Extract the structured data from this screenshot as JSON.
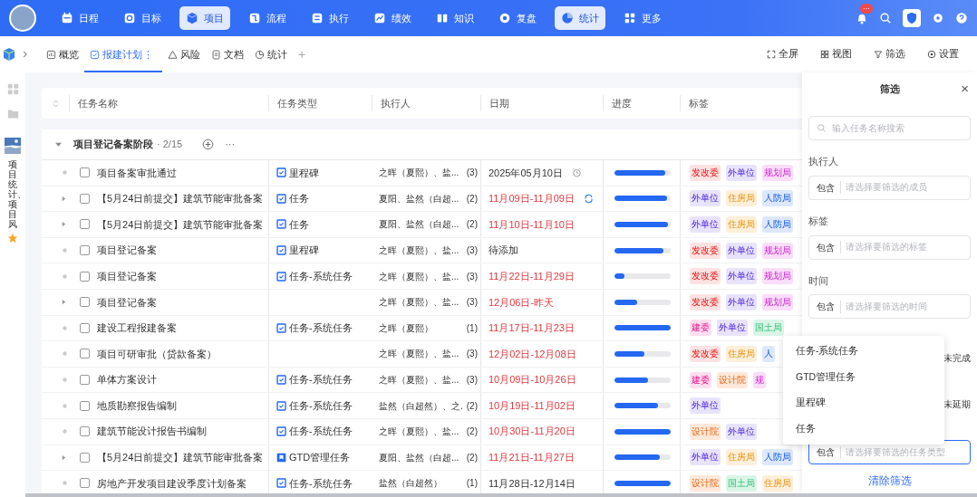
{
  "nav": {
    "items": [
      {
        "label": "日程",
        "selected": false
      },
      {
        "label": "目标",
        "selected": false
      },
      {
        "label": "项目",
        "selected": true
      },
      {
        "label": "流程",
        "selected": false
      },
      {
        "label": "执行",
        "selected": false
      },
      {
        "label": "绩效",
        "selected": false
      },
      {
        "label": "知识",
        "selected": false
      },
      {
        "label": "复盘",
        "selected": false
      },
      {
        "label": "统计",
        "selected": true
      },
      {
        "label": "更多",
        "selected": false
      }
    ],
    "notification_badge": "···"
  },
  "tabs": [
    {
      "label": "概览",
      "selected": false
    },
    {
      "label": "报建计划",
      "selected": true
    },
    {
      "label": "风险",
      "selected": false
    },
    {
      "label": "文档",
      "selected": false
    },
    {
      "label": "统计",
      "selected": false
    }
  ],
  "tab_menu": "⋮",
  "tab_add": "+",
  "toolbar": [
    "全屏",
    "视图",
    "筛选",
    "设置"
  ],
  "rail": {
    "vertical_text": "项目统计、项目风"
  },
  "table": {
    "columns": [
      "任务名称",
      "任务类型",
      "执行人",
      "日期",
      "进度",
      "标签"
    ],
    "group": {
      "name": "项目登记备案阶段",
      "count": "· 2/15",
      "more": "···",
      "expanded": true
    },
    "rows": [
      {
        "expandable": false,
        "checked": false,
        "name": "项目备案审批通过",
        "type": {
          "kind": "check",
          "label": "里程碑"
        },
        "executor": "之晖（夏熙）、盐...",
        "count": "(3)",
        "date": "2025年05月10日",
        "overdue": false,
        "reminder": true,
        "level": 0.9,
        "tags": [
          {
            "label": "发改委",
            "color": "#fde2e2"
          },
          {
            "label": "外单位",
            "color": "#e8e3fc"
          },
          {
            "label": "规划局",
            "color": "#f9ddf9"
          }
        ]
      },
      {
        "expandable": true,
        "checked": false,
        "name": "【5月24日前提交】建筑节能审批备案",
        "type": {
          "kind": "check",
          "label": "任务"
        },
        "executor": "夏阳、盐然（白超...",
        "count": "(2)",
        "date": "11月09日-11月09日",
        "overdue": true,
        "recurring": true,
        "level": 0.93,
        "tags": [
          {
            "label": "外单位",
            "color": "#e8e3fc"
          },
          {
            "label": "住房局",
            "color": "#fdefd9"
          },
          {
            "label": "人防局",
            "color": "#dde8fd"
          }
        ]
      },
      {
        "expandable": true,
        "checked": false,
        "name": "【5月24日前提交】建筑节能审批备案",
        "type": {
          "kind": "check",
          "label": "任务"
        },
        "executor": "夏阳、盐然（白超...",
        "count": "(2)",
        "date": "11月10日-11月10日",
        "overdue": true,
        "level": 0.95,
        "tags": [
          {
            "label": "外单位",
            "color": "#e8e3fc"
          },
          {
            "label": "住房局",
            "color": "#fdefd9"
          },
          {
            "label": "人防局",
            "color": "#dde8fd"
          }
        ]
      },
      {
        "expandable": false,
        "checked": false,
        "name": "项目登记备案",
        "type": {
          "kind": "check",
          "label": "里程碑"
        },
        "executor": "之晖（夏熙）、盐...",
        "count": "(3)",
        "date": "待添加",
        "overdue": false,
        "level": 0.87,
        "tags": [
          {
            "label": "发改委",
            "color": "#fde2e2"
          },
          {
            "label": "外单位",
            "color": "#e8e3fc"
          },
          {
            "label": "规划局",
            "color": "#f9ddf9"
          }
        ]
      },
      {
        "expandable": false,
        "checked": false,
        "name": "项目登记备案",
        "type": {
          "kind": "check",
          "label": "任务-系统任务"
        },
        "executor": "之晖（夏熙）、盐...",
        "count": "(3)",
        "date": "11月22日-11月29日",
        "overdue": true,
        "level": 0.17,
        "tags": [
          {
            "label": "发改委",
            "color": "#fde2e2"
          },
          {
            "label": "外单位",
            "color": "#e8e3fc"
          },
          {
            "label": "规划局",
            "color": "#f9ddf9"
          }
        ]
      },
      {
        "expandable": true,
        "checked": false,
        "name": "项目登记备案",
        "executor": "之晖（夏熙）、盐...",
        "count": "(3)",
        "date": "12月06日-昨天",
        "overdue": true,
        "level": 0.41,
        "tags": [
          {
            "label": "发改委",
            "color": "#fde2e2"
          },
          {
            "label": "外单位",
            "color": "#e8e3fc"
          },
          {
            "label": "规划局",
            "color": "#f9ddf9"
          }
        ]
      },
      {
        "expandable": false,
        "checked": false,
        "name": "建设工程报建备案",
        "type": {
          "kind": "check",
          "label": "任务-系统任务"
        },
        "executor": "之晖（夏熙）",
        "count": "(1)",
        "date": "11月17日-11月23日",
        "overdue": true,
        "level": 1.0,
        "tags": [
          {
            "label": "建委",
            "color": "#fddff0"
          },
          {
            "label": "外单位",
            "color": "#e8e3fc"
          },
          {
            "label": "国土局",
            "color": "#daf5e7"
          }
        ]
      },
      {
        "expandable": false,
        "checked": false,
        "name": "项目可研审批（贷款备案）",
        "executor": "之晖（夏熙）、盐...",
        "count": "(3)",
        "date": "12月02日-12月08日",
        "overdue": true,
        "level": 0.54,
        "tags": [
          {
            "label": "发改委",
            "color": "#fde2e2"
          },
          {
            "label": "住房局",
            "color": "#fdefd9"
          },
          {
            "label": "人",
            "color": "#dde8fd"
          }
        ]
      },
      {
        "expandable": false,
        "checked": false,
        "name": "单体方案设计",
        "type": {
          "kind": "check",
          "label": "任务-系统任务"
        },
        "executor": "之晖（夏熙）、盐...",
        "count": "(3)",
        "date": "10月09日-10月26日",
        "overdue": true,
        "level": 0.6,
        "tags": [
          {
            "label": "建委",
            "color": "#fddff0"
          },
          {
            "label": "设计院",
            "color": "#fde8da"
          },
          {
            "label": "规",
            "color": "#f9ddf9"
          }
        ]
      },
      {
        "expandable": false,
        "checked": false,
        "name": "地质勘察报告编制",
        "type": {
          "kind": "check",
          "label": "任务-系统任务"
        },
        "executor": "盐然（白超然）、之.",
        "count": "(2)",
        "date": "10月19日-11月02日",
        "overdue": true,
        "level": 0.78,
        "tags": [
          {
            "label": "外单位",
            "color": "#e8e3fc"
          }
        ]
      },
      {
        "expandable": false,
        "checked": false,
        "name": "建筑节能设计报告书编制",
        "type": {
          "kind": "check",
          "label": "任务-系统任务"
        },
        "executor": "之晖（夏熙）、盐...",
        "count": "(2)",
        "date": "10月30日-11月20日",
        "overdue": true,
        "level": 1.0,
        "tags": [
          {
            "label": "设计院",
            "color": "#fde8da"
          },
          {
            "label": "外单位",
            "color": "#e8e3fc"
          }
        ]
      },
      {
        "expandable": true,
        "checked": false,
        "name": "【5月24日前提交】建筑节能审批备案",
        "type": {
          "kind": "gtd",
          "label": "GTD管理任务"
        },
        "executor": "夏阳、盐然（白超...",
        "count": "(2)",
        "date": "11月21日-11月27日",
        "overdue": true,
        "level": 0.81,
        "tags": [
          {
            "label": "外单位",
            "color": "#e8e3fc"
          },
          {
            "label": "住房局",
            "color": "#fdefd9"
          },
          {
            "label": "人防局",
            "color": "#dde8fd"
          }
        ]
      },
      {
        "expandable": false,
        "checked": false,
        "name": "房地产开发项目建设季度计划备案",
        "type": {
          "kind": "check",
          "label": "任务-系统任务"
        },
        "executor": "盐然（白超然）",
        "count": "(1)",
        "date": "11月28日-12月14日",
        "overdue": false,
        "level": 1.0,
        "tags": [
          {
            "label": "设计院",
            "color": "#fde8da"
          },
          {
            "label": "国土局",
            "color": "#daf5e7"
          },
          {
            "label": "住房局",
            "color": "#fdefd9"
          }
        ]
      }
    ]
  },
  "filter_panel": {
    "title": "筛选",
    "close": "×",
    "search": {
      "placeholder": "输入任务名称搜索"
    },
    "sections": [
      {
        "label": "执行人",
        "prefix": "包含",
        "placeholder": "请选择要筛选的成员"
      },
      {
        "label": "标签",
        "prefix": "包含",
        "placeholder": "请选择要筛选的标签"
      },
      {
        "label": "时间",
        "prefix": "包含",
        "placeholder": "请选择要筛选的时间"
      }
    ],
    "status_values": [
      "未完成",
      "未延期"
    ],
    "type_field": {
      "prefix": "包含",
      "placeholder": "请选择要筛选的任务类型",
      "focused": true
    },
    "clear": "清除筛选"
  },
  "dropdown": {
    "items": [
      "任务-系统任务",
      "GTD管理任务",
      "里程碑",
      "任务"
    ]
  }
}
